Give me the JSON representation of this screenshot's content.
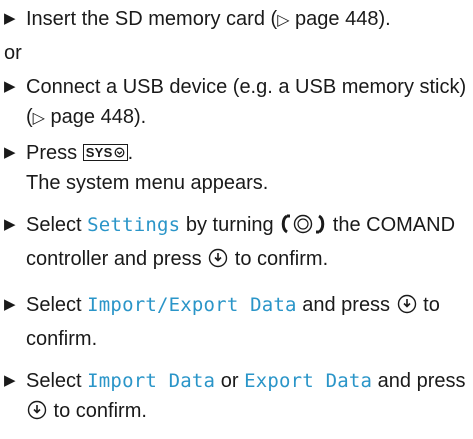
{
  "steps": [
    {
      "bullet": "▶",
      "text_1": "Insert the SD memory card (",
      "ref_glyph": "▷",
      "ref_text": " page 448",
      "text_2": ")."
    },
    {
      "bullet": "▶",
      "text_1": "Connect a USB device (e.g. a USB memory stick) (",
      "ref_glyph": "▷",
      "ref_text": " page 448",
      "text_2": ")."
    },
    {
      "bullet": "▶",
      "text_1": "Press ",
      "key_label": "SYS",
      "text_2": ".",
      "result": "The system menu appears."
    },
    {
      "bullet": "▶",
      "text_1": "Select ",
      "term": "Settings",
      "text_2": " by turning ",
      "text_3": " the COMAND controller and press ",
      "text_4": " to confirm."
    },
    {
      "bullet": "▶",
      "text_1": "Select ",
      "term": "Import/Export Data",
      "text_2": " and press ",
      "text_3": " to confirm."
    },
    {
      "bullet": "▶",
      "text_1": "Select ",
      "term_1": "Import Data",
      "text_2": " or ",
      "term_2": "Export Data",
      "text_3": " and press ",
      "text_4": " to confirm."
    }
  ],
  "separator": "or",
  "icons": {
    "key_icon": "sys-key-icon",
    "turn_icon": "controller-turn-icon",
    "press_icon": "controller-press-icon"
  },
  "colors": {
    "term": "#2a95c8",
    "text": "#1a1a1a"
  }
}
